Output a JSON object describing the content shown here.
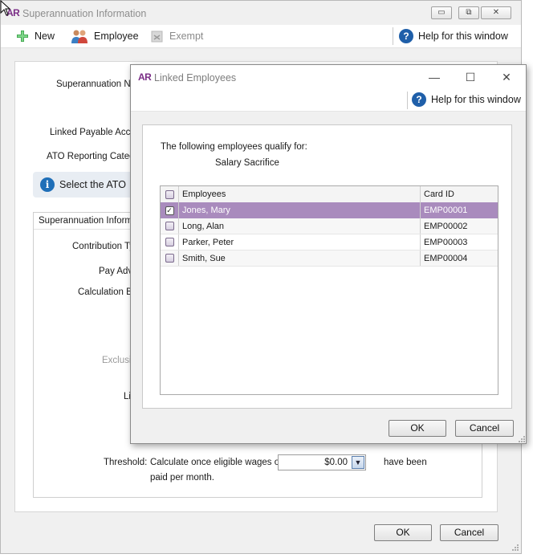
{
  "main": {
    "logo": "AR",
    "title": "Superannuation Information",
    "toolbar": {
      "new_label": "New",
      "employee_label": "Employee",
      "exempt_label": "Exempt",
      "help_label": "Help for this window"
    },
    "fields": {
      "superannuation_name_label": "Superannuation Na",
      "linked_payable_label": "Linked Payable Accou",
      "ato_reporting_label": "ATO Reporting Catego",
      "info_banner_text": "Select the ATO",
      "group_title": "Superannuation Informa",
      "contribution_type_label": "Contribution Ty",
      "pay_advice_label": "Pay Adv",
      "calculation_basis_label": "Calculation Ba",
      "exclusions_label": "Exclusio",
      "limits_label": "Li",
      "threshold_label": "Threshold:",
      "threshold_text_before": "Calculate once eligible wages of",
      "threshold_value": "$0.00",
      "threshold_text_after": "have been",
      "threshold_text_end": "paid per month."
    },
    "ok_label": "OK",
    "cancel_label": "Cancel"
  },
  "dialog": {
    "logo": "AR",
    "title": "Linked Employees",
    "help_label": "Help for this window",
    "intro_text": "The following employees qualify for:",
    "category": "Salary Sacrifice",
    "columns": {
      "employees": "Employees",
      "card_id": "Card ID"
    },
    "rows": [
      {
        "name": "Jones, Mary",
        "card_id": "EMP00001",
        "checked": true,
        "selected": true
      },
      {
        "name": "Long, Alan",
        "card_id": "EMP00002",
        "checked": false,
        "selected": false
      },
      {
        "name": "Parker, Peter",
        "card_id": "EMP00003",
        "checked": false,
        "selected": false
      },
      {
        "name": "Smith, Sue",
        "card_id": "EMP00004",
        "checked": false,
        "selected": false
      }
    ],
    "ok_label": "OK",
    "cancel_label": "Cancel"
  },
  "colors": {
    "selected_row": "#a98bbd",
    "brand": "#7a2d86",
    "help_icon": "#1f5fa9"
  }
}
